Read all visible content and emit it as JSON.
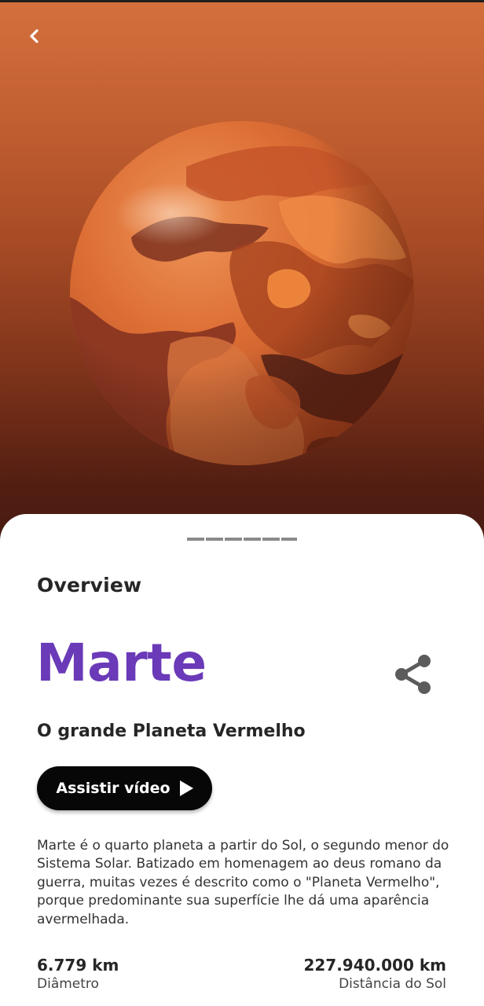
{
  "overview": {
    "heading": "Overview"
  },
  "planet": {
    "name": "Marte",
    "subtitle": "O grande Planeta Vermelho",
    "description": "Marte é o quarto planeta a partir do Sol, o segundo menor do Sistema Solar. Batizado em homenagem ao deus romano da guerra, muitas vezes é descrito como o \"Planeta Vermelho\", porque predominante sua superfície lhe dá uma aparência avermelhada."
  },
  "actions": {
    "video_label": "Assistir vídeo"
  },
  "stats": {
    "diameter_value": "6.779 km",
    "diameter_label": "Diâmetro",
    "distance_value": "227.940.000 km",
    "distance_label": "Distância do Sol"
  },
  "icons": {
    "back": "chevron-left-icon",
    "share": "share-icon",
    "play": "play-icon"
  },
  "colors": {
    "planet_name": "#6a3ab8",
    "hero_top": "#d4703d",
    "hero_bottom": "#461a11",
    "video_button": "#070707"
  }
}
